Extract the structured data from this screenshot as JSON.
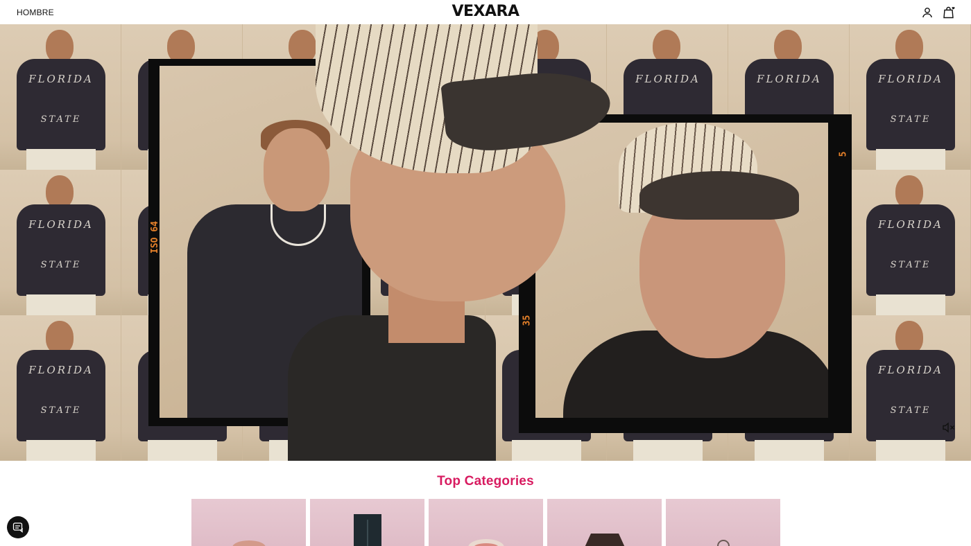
{
  "header": {
    "nav_label": "HOMBRE",
    "logo_text": "VEXARA",
    "account_icon": "user-icon",
    "bag_icon": "shopping-bag-icon"
  },
  "hero": {
    "film_marks": {
      "iso": "ISO 64",
      "frame_number_a": "5",
      "frame_number_b": "35"
    },
    "tile_text_top": "FLORIDA",
    "tile_text_bottom": "STATE",
    "mute_icon": "volume-mute-icon"
  },
  "categories": {
    "title": "Top Categories",
    "items": [
      {
        "name": "category-1",
        "object_color": "#d8a090"
      },
      {
        "name": "category-2",
        "object_color": "#1f2a30"
      },
      {
        "name": "category-3",
        "object_color": "#e8c8b8"
      },
      {
        "name": "category-4",
        "object_color": "#3a2a26"
      },
      {
        "name": "category-5",
        "object_color": "#f0e6e0"
      }
    ]
  },
  "chat": {
    "icon": "chat-icon"
  },
  "colors": {
    "accent": "#d81b60",
    "header_bg": "#ffffff",
    "text": "#111111"
  }
}
